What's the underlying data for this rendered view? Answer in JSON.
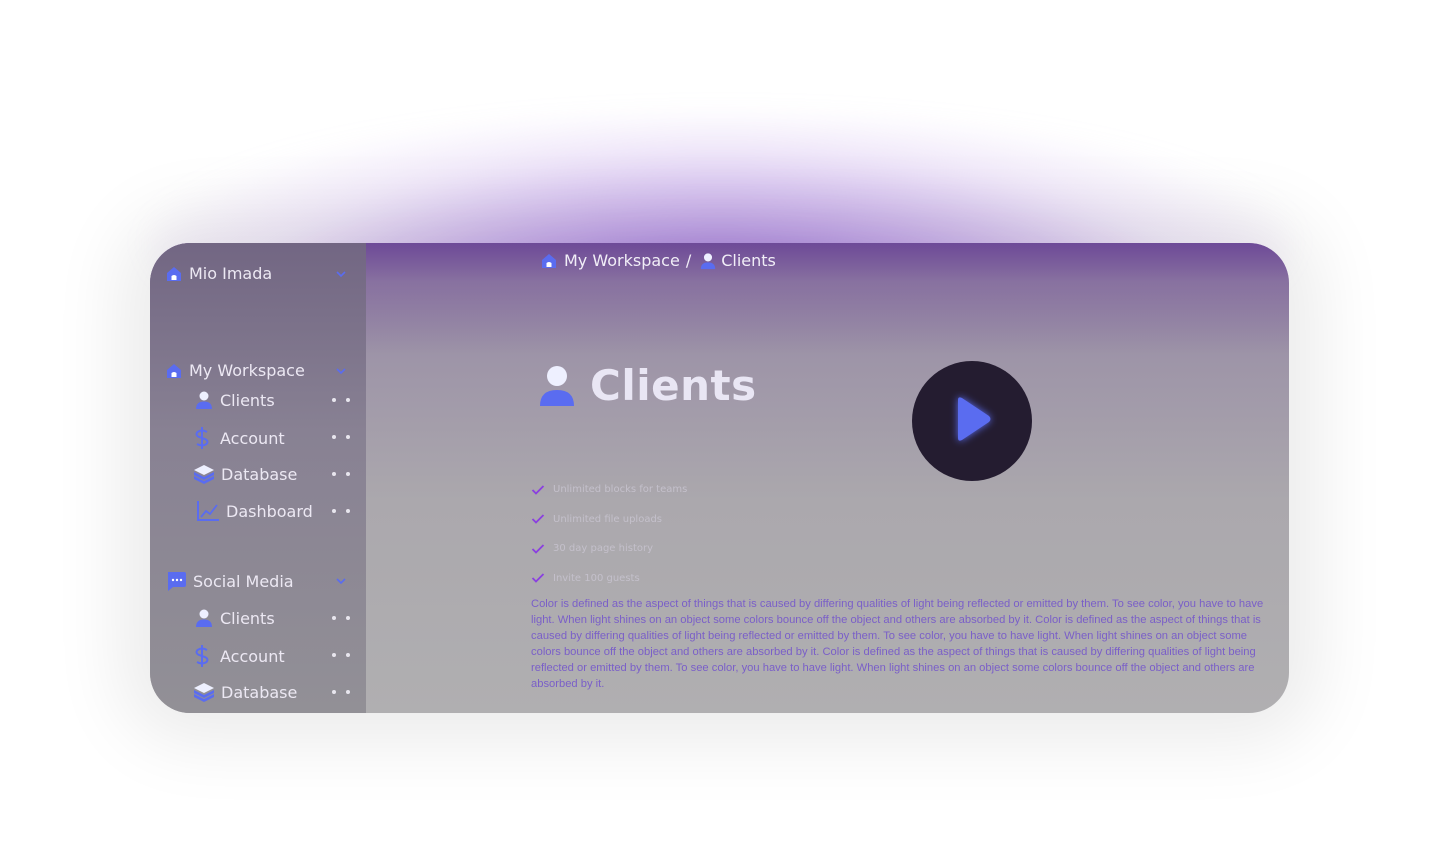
{
  "colors": {
    "accent_blue": "#5a6cf0",
    "accent_purple": "#8a3fe0",
    "text_light": "#ece8f3",
    "play_bg": "#241c30"
  },
  "sidebar": {
    "user": {
      "name": "Mio Imada",
      "icon": "home-icon"
    },
    "groups": [
      {
        "title": "My Workspace",
        "icon": "home-icon",
        "items": [
          {
            "label": "Clients",
            "icon": "user-icon"
          },
          {
            "label": "Account",
            "icon": "dollar-icon"
          },
          {
            "label": "Database",
            "icon": "layers-icon"
          },
          {
            "label": "Dashboard",
            "icon": "chart-icon"
          }
        ]
      },
      {
        "title": "Social Media",
        "icon": "chat-icon",
        "items": [
          {
            "label": "Clients",
            "icon": "user-icon"
          },
          {
            "label": "Account",
            "icon": "dollar-icon"
          },
          {
            "label": "Database",
            "icon": "layers-icon"
          }
        ]
      }
    ]
  },
  "breadcrumb": {
    "workspace": "My Workspace",
    "separator": "/",
    "current": "Clients"
  },
  "main": {
    "title": "Clients",
    "checklist": [
      "Unlimited blocks for teams",
      "Unlimited file uploads",
      "30 day page history",
      "Invite 100 guests"
    ],
    "body": "Color is defined as the aspect of things that is caused by differing qualities of light being reflected or emitted by them. To see color, you have to have light. When light shines on an object some colors bounce off the object and others are absorbed by it. Color is defined as the aspect of things that is caused by differing qualities of light being reflected or emitted by them. To see color, you have to have light. When light shines on an object some colors bounce off the object and others are absorbed by it. Color is defined as the aspect of things that is caused by differing qualities of light being reflected or emitted by them. To see color, you have to have light. When light shines on an object some colors bounce off the object and others are absorbed by it."
  }
}
